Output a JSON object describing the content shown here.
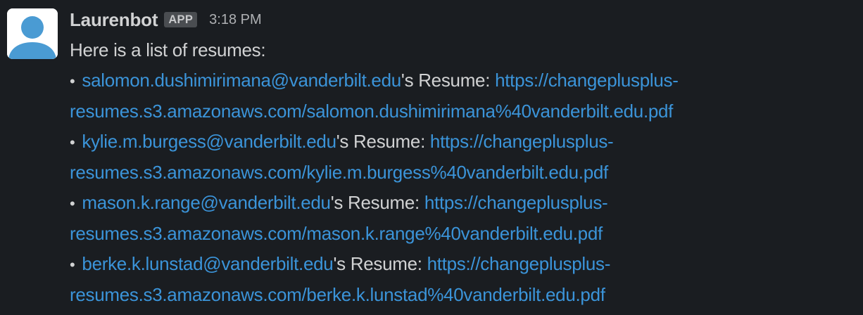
{
  "message": {
    "sender": "Laurenbot",
    "badge": "APP",
    "timestamp": "3:18 PM",
    "intro": "Here is a list of resumes:",
    "items": [
      {
        "email": "salomon.dushimirimana@vanderbilt.edu",
        "label": "'s Resume: ",
        "url_line1": "https://changeplusplus-",
        "url_line2": "resumes.s3.amazonaws.com/salomon.dushimirimana%40vanderbilt.edu.pdf"
      },
      {
        "email": "kylie.m.burgess@vanderbilt.edu",
        "label": "'s Resume: ",
        "url_line1": "https://changeplusplus-",
        "url_line2": "resumes.s3.amazonaws.com/kylie.m.burgess%40vanderbilt.edu.pdf"
      },
      {
        "email": "mason.k.range@vanderbilt.edu",
        "label": "'s Resume: ",
        "url_line1": "https://changeplusplus-",
        "url_line2": "resumes.s3.amazonaws.com/mason.k.range%40vanderbilt.edu.pdf"
      },
      {
        "email": "berke.k.lunstad@vanderbilt.edu",
        "label": "'s Resume: ",
        "url_line1": "https://changeplusplus-",
        "url_line2": "resumes.s3.amazonaws.com/berke.k.lunstad%40vanderbilt.edu.pdf"
      }
    ]
  },
  "colors": {
    "background": "#1a1d21",
    "text": "#d1d2d3",
    "link": "#3b94d9",
    "avatar_figure": "#4a9bd3",
    "badge_bg": "#4a4d51"
  },
  "icons": {
    "avatar": "default-user-avatar-icon",
    "bullet": "•"
  }
}
